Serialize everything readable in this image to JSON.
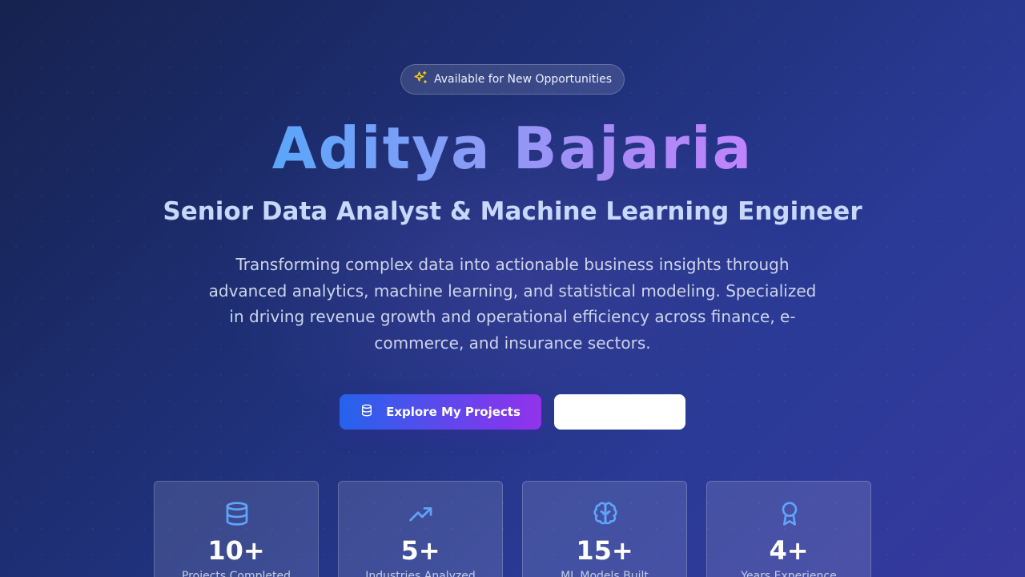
{
  "hero": {
    "badge": {
      "icon": "sparkles-icon",
      "label": "Available for New Opportunities"
    },
    "name": "Aditya Bajaria",
    "role": "Senior Data Analyst & Machine Learning Engineer",
    "description": "Transforming complex data into actionable business insights through advanced analytics, machine learning, and statistical modeling. Specialized in driving revenue growth and operational efficiency across finance, e-commerce, and insurance sectors.",
    "primary_button": {
      "icon": "database-icon",
      "label": "Explore My Projects"
    },
    "secondary_button": {
      "label": ""
    }
  },
  "stats": [
    {
      "icon": "database-icon",
      "value": "10+",
      "label": "Projects Completed"
    },
    {
      "icon": "trending-up-icon",
      "value": "5+",
      "label": "Industries Analyzed"
    },
    {
      "icon": "brain-icon",
      "value": "15+",
      "label": "ML Models Built"
    },
    {
      "icon": "award-icon",
      "value": "4+",
      "label": "Years Experience"
    }
  ],
  "colors": {
    "accent_blue": "#60a5fa",
    "accent_purple": "#c084fc",
    "badge_icon": "#facc15",
    "stat_icon": "#60a5fa"
  }
}
